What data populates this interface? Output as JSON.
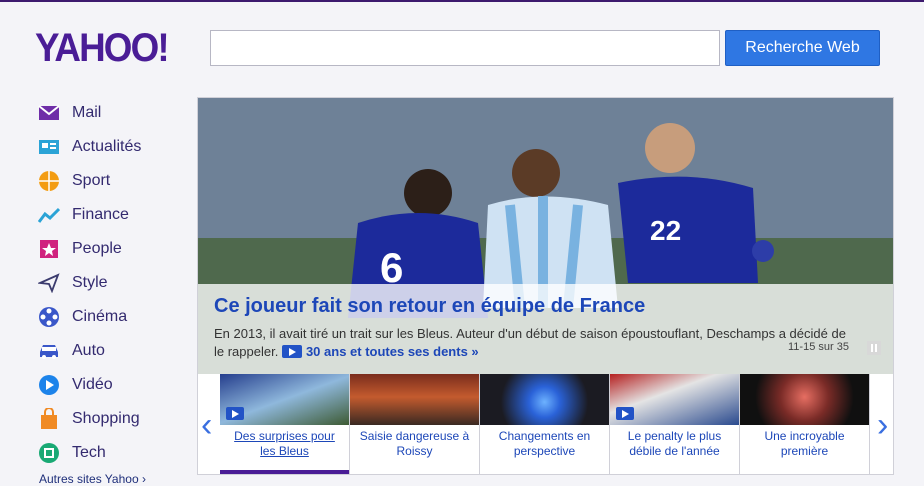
{
  "header": {
    "logo": "YAHOO!",
    "search_placeholder": "",
    "search_button": "Recherche Web"
  },
  "nav": {
    "items": [
      {
        "label": "Mail",
        "icon": "mail-icon"
      },
      {
        "label": "Actualités",
        "icon": "news-icon"
      },
      {
        "label": "Sport",
        "icon": "sport-icon"
      },
      {
        "label": "Finance",
        "icon": "finance-icon"
      },
      {
        "label": "People",
        "icon": "people-icon"
      },
      {
        "label": "Style",
        "icon": "style-icon"
      },
      {
        "label": "Cinéma",
        "icon": "cinema-icon"
      },
      {
        "label": "Auto",
        "icon": "auto-icon"
      },
      {
        "label": "Vidéo",
        "icon": "video-icon"
      },
      {
        "label": "Shopping",
        "icon": "shopping-icon"
      },
      {
        "label": "Tech",
        "icon": "tech-icon"
      }
    ],
    "more": "Autres sites Yahoo ›"
  },
  "hero": {
    "headline": "Ce joueur fait son retour en équipe de France",
    "summary": "En 2013, il avait tiré un trait sur les Bleus. Auteur d'un début de saison époustouflant, Deschamps a décidé de le rappeler.",
    "link": "30 ans et toutes ses dents »",
    "counter": "11-15 sur 35"
  },
  "thumbs": [
    {
      "caption": "Des surprises pour les Bleus",
      "video": true
    },
    {
      "caption": "Saisie dangereuse à Roissy",
      "video": false
    },
    {
      "caption": "Changements en perspective",
      "video": false
    },
    {
      "caption": "Le penalty le plus débile de l'année",
      "video": true
    },
    {
      "caption": "Une incroyable première",
      "video": false
    }
  ],
  "colors": {
    "brand": "#4a1d96",
    "link": "#1d47b8",
    "button": "#2f77e3"
  }
}
